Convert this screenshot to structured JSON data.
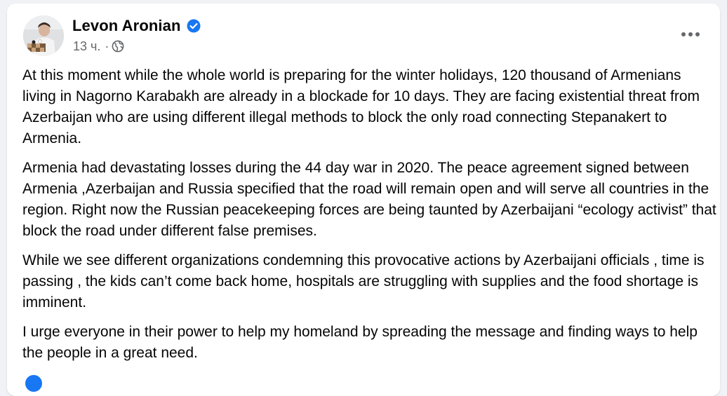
{
  "post": {
    "author": "Levon Aronian",
    "time": "13 ч.",
    "separator": "·",
    "audience_icon": "globe-icon",
    "verified_icon": "verified-badge-icon",
    "more_icon": "more-options-icon",
    "paragraphs": [
      "At this moment while the whole world is preparing for the winter holidays, 120 thousand of Armenians living in Nagorno Karabakh are already in a blockade for 10 days. They are facing existential threat from Azerbaijan who are using different illegal methods to block the only road connecting Stepanakert to Armenia.",
      "Armenia had devastating losses during the 44 day war in 2020. The peace agreement signed between Armenia ,Azerbaijan and Russia specified that the road will remain open and will serve all countries in the region. Right now the Russian peacekeeping forces are being taunted by Azerbaijani “ecology activist” that block the road under different false premises.",
      "While we see different organizations condemning this provocative actions by Azerbaijani officials , time is passing , the kids can’t come back home, hospitals are struggling with supplies and the food shortage is imminent.",
      "I urge everyone in their power to help my homeland by spreading the message and finding ways to help the people in a great need."
    ]
  },
  "colors": {
    "background": "#f0f2f5",
    "card": "#ffffff",
    "text_primary": "#050505",
    "text_secondary": "#65676b",
    "accent": "#1877f2"
  }
}
